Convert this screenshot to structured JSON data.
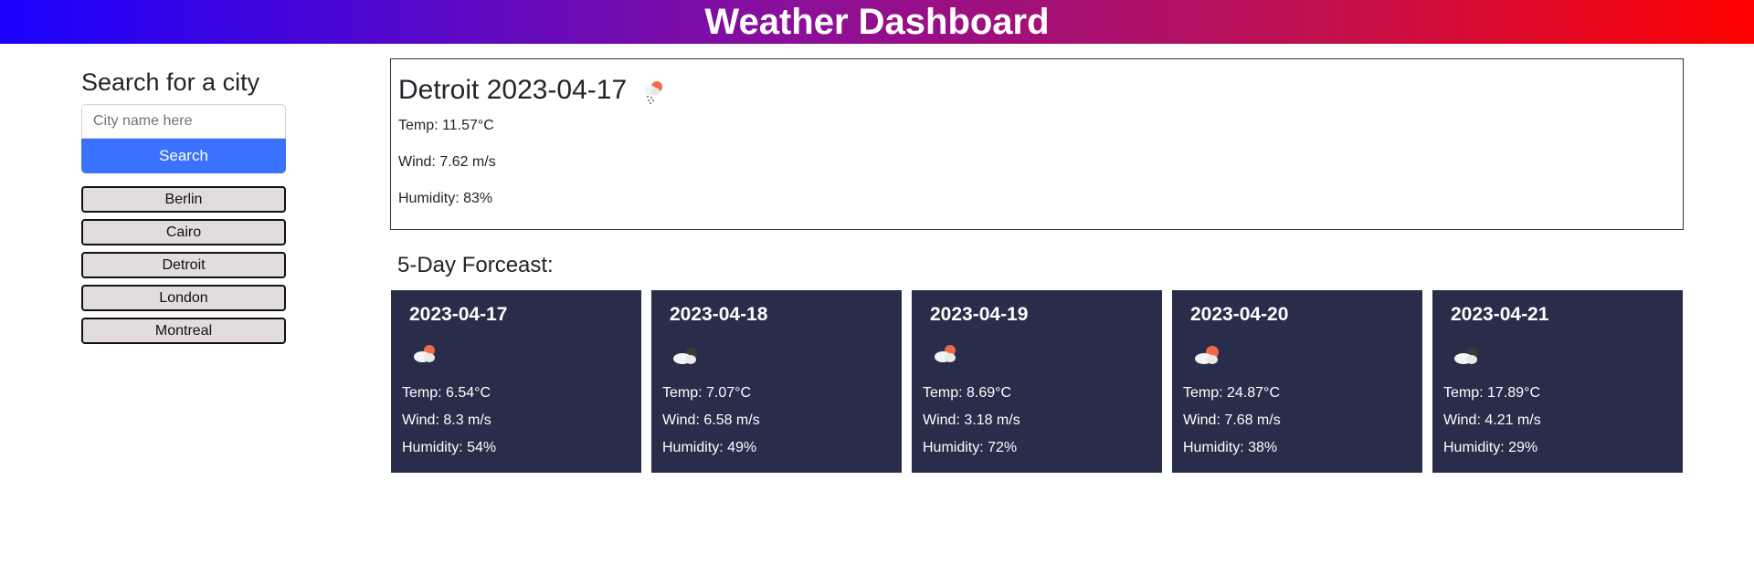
{
  "header": {
    "title": "Weather Dashboard"
  },
  "sidebar": {
    "heading": "Search for a city",
    "search_placeholder": "City name here",
    "search_value": "",
    "search_button": "Search",
    "history": [
      "Berlin",
      "Cairo",
      "Detroit",
      "London",
      "Montreal"
    ]
  },
  "current": {
    "title": "Detroit 2023-04-17",
    "icon": "rain-sun-cloud-icon",
    "temp": "Temp: 11.57°C",
    "wind": "Wind: 7.62 m/s",
    "humidity": "Humidity: 83%"
  },
  "forecast": {
    "heading": "5-Day Forceast:",
    "days": [
      {
        "date": "2023-04-17",
        "icon": "cloud-sun-icon",
        "temp": "Temp: 6.54°C",
        "wind": "Wind: 8.3 m/s",
        "humidity": "Humidity: 54%"
      },
      {
        "date": "2023-04-18",
        "icon": "cloud-moon-icon",
        "temp": "Temp: 7.07°C",
        "wind": "Wind: 6.58 m/s",
        "humidity": "Humidity: 49%"
      },
      {
        "date": "2023-04-19",
        "icon": "cloud-sun-icon",
        "temp": "Temp: 8.69°C",
        "wind": "Wind: 3.18 m/s",
        "humidity": "Humidity: 72%"
      },
      {
        "date": "2023-04-20",
        "icon": "cloud-sun-icon",
        "temp": "Temp: 24.87°C",
        "wind": "Wind: 7.68 m/s",
        "humidity": "Humidity: 38%"
      },
      {
        "date": "2023-04-21",
        "icon": "cloud-moon-icon",
        "temp": "Temp: 17.89°C",
        "wind": "Wind: 4.21 m/s",
        "humidity": "Humidity: 29%"
      }
    ]
  },
  "colors": {
    "header_gradient_start": "#1a00ff",
    "header_gradient_end": "#ff0000",
    "search_button": "#3a72ff",
    "history_button": "#e3dcdc",
    "forecast_card": "#292d4a",
    "sun": "#f06a4a"
  }
}
